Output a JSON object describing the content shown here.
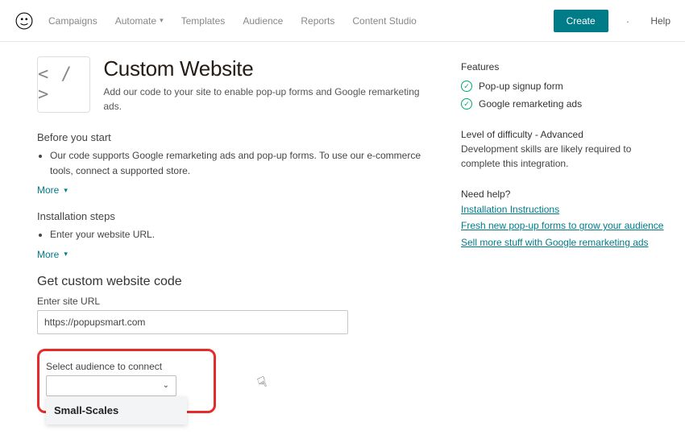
{
  "nav": {
    "items": [
      "Campaigns",
      "Automate",
      "Templates",
      "Audience",
      "Reports",
      "Content Studio"
    ],
    "create_label": "Create",
    "help_label": "Help"
  },
  "header": {
    "title": "Custom Website",
    "subtitle": "Add our code to your site to enable pop-up forms and Google remarketing ads.",
    "icon_text": "< / >"
  },
  "before_start": {
    "title": "Before you start",
    "bullet": "Our code supports Google remarketing ads and pop-up forms. To use our e-commerce tools, connect a supported store.",
    "more_label": "More"
  },
  "installation": {
    "title": "Installation steps",
    "bullet": "Enter your website URL.",
    "more_label": "More"
  },
  "get_code": {
    "heading": "Get custom website code",
    "url_label": "Enter site URL",
    "url_value": "https://popupsmart.com",
    "select_label": "Select audience to connect",
    "select_value": "",
    "dropdown_option": "Small-Scales"
  },
  "features": {
    "title": "Features",
    "items": [
      "Pop-up signup form",
      "Google remarketing ads"
    ]
  },
  "difficulty": {
    "label": "Level of difficulty - Advanced",
    "body": "Development skills are likely required to complete this integration."
  },
  "help": {
    "title": "Need help?",
    "links": [
      "Installation Instructions",
      "Fresh new pop-up forms to grow your audience",
      "Sell more stuff with Google remarketing ads"
    ]
  }
}
